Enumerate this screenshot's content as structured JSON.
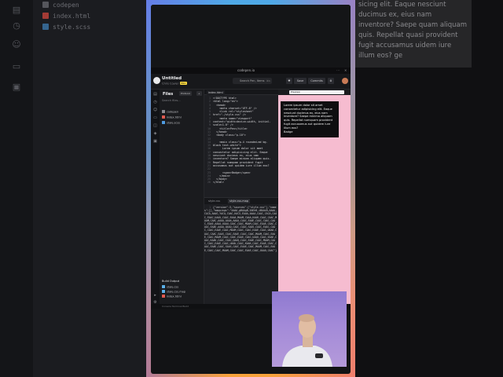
{
  "background": {
    "left_files": [
      "codepen",
      "index.html",
      "style.scss"
    ],
    "right_text": "sicing elit. Eaque nesciunt ducimus ex, eius nam inventore? Saepe quam aliquam quis. Repellat quasi provident fugit accusamus uidem iure illum eos? ge"
  },
  "browser": {
    "url": "codepen.io"
  },
  "topbar": {
    "title": "Untitled",
    "subtitle": "Chris Coyier",
    "pro_badge": "PRO",
    "search_placeholder": "Search Pen, Items",
    "search_shortcut": "⌘K",
    "save_label": "Save",
    "commits_label": "Commits"
  },
  "files": {
    "title": "Files",
    "protocol_label": "Protocol",
    "add_label": "+",
    "search_placeholder": "Search files...",
    "items": [
      {
        "name": "codepen",
        "color": "#8b8b90"
      },
      {
        "name": "index.html",
        "color": "#e05a4f"
      },
      {
        "name": "style.scss",
        "color": "#4f9be0"
      }
    ],
    "build_title": "Build Output",
    "build_items": [
      {
        "name": "style.css",
        "color": "#5ab0e8"
      },
      {
        "name": "style.css.map",
        "color": "#5ab0e8"
      },
      {
        "name": "index.html",
        "color": "#e05a4f"
      }
    ]
  },
  "editor": {
    "tab_top": "index.html",
    "code_top": [
      "<!DOCTYPE html>",
      "<html lang=\"en\">",
      "  <head>",
      "    <meta charset=\"UTF-8\" />",
      "    <link rel=\"stylesheet\"",
      "href=\"./style.css\" />",
      "    <meta name=\"viewport\"",
      "content=\"width=device-width, initial-",
      "scale=1.0\" />",
      "    <title>Pen</title>",
      "  </head>",
      "  <body class=\"p-10\">",
      "",
      "    <main class=\"p-4 rounded-md bg-",
      "black text-white\">",
      "      Lorem ipsum dolor sit amet",
      "consectetur adipisicing elit. Eaque",
      "nesciunt ducimus ex, eius nam",
      "inventore? Saepe minima aliquam quis.",
      "Repellat numquam provident fugit",
      "accusamus aut quidem iure illum eos?",
      "",
      "      <span>Badge</span>",
      "    </main>",
      "  </body>",
      "</html>"
    ],
    "tab_bottom_1": "style.css",
    "tab_bottom_2": "style.css.map",
    "code_bottom": "{\"version\":3,\"sources\":[\"style.css\"],\"names\":[],\"mappings\":\"AAAA,gBAAgB,EAEhB,iBAAiB,AAAA,CACA,AAAG,YACA,CAAC,KACX,EAAA,AAAA,CAAC,CACA,CAAC,EAAC,UAAU,CAAC,EAAA,MAAM,CAAA,KAAK,CAAC,CAAC,MAAM,CAAC,AAAA,AAAA,AAAA,CAAC,EAAE,CAAC,CAAC,CAAC,EAAE,AAAA,UAAU,CAAC,CAAC,MAAM,CAAC,EAAE,CAAC,CAAC,EAAE,AAAA,QAAQ,CAAC,CAAC,SAAS,CAAC,EAAC,CAAC,CAAC,EAAE,CAAC,MAAM,CAAC,CAAC,EAAE,CAAC,OAAO,CAAC,CAAC,SAAS,CAAC,EAAE,CAAC,CAAC,MAAM,CAAC,EAAE,CAAC,MAAM,CAAC,CAAC,EAAE,CAAC,UAAU,CAAC,EAAE,CAAC,KAAK,CAAC,CAAC,QAAQ,CAAC,EAAE,CAAC,MAAM,CAAC,CAAC,EAAE,CAAC,UAAU,CAAC,KAAK,CAAC,EAAE,CAAC,CAAC,EAAE,CAAC,SAAS,CAAC,EAAE,CAAC,MAAM,CAAC,EAAE,CAAC,CAAC,MAAM,CAAC,CAAC,EAAE,CAAC,OAAO,CAAC\"}"
  },
  "preview": {
    "label": "Preview",
    "box_text": "Lorem ipsum dolor sit amet consectetur adipisicing elit. Eaque nesciunt ducimus ex, eius nam inventore? Saepe minima aliquam quis. Repellat numquam provident fugit accusamus aut quidem iure illum eos?",
    "badge": "Badge"
  },
  "status": {
    "text": "Console   Terminal   Build"
  },
  "colors": {
    "preview_bg": "#f6bcd0",
    "accent_yellow": "#ffdd40"
  }
}
